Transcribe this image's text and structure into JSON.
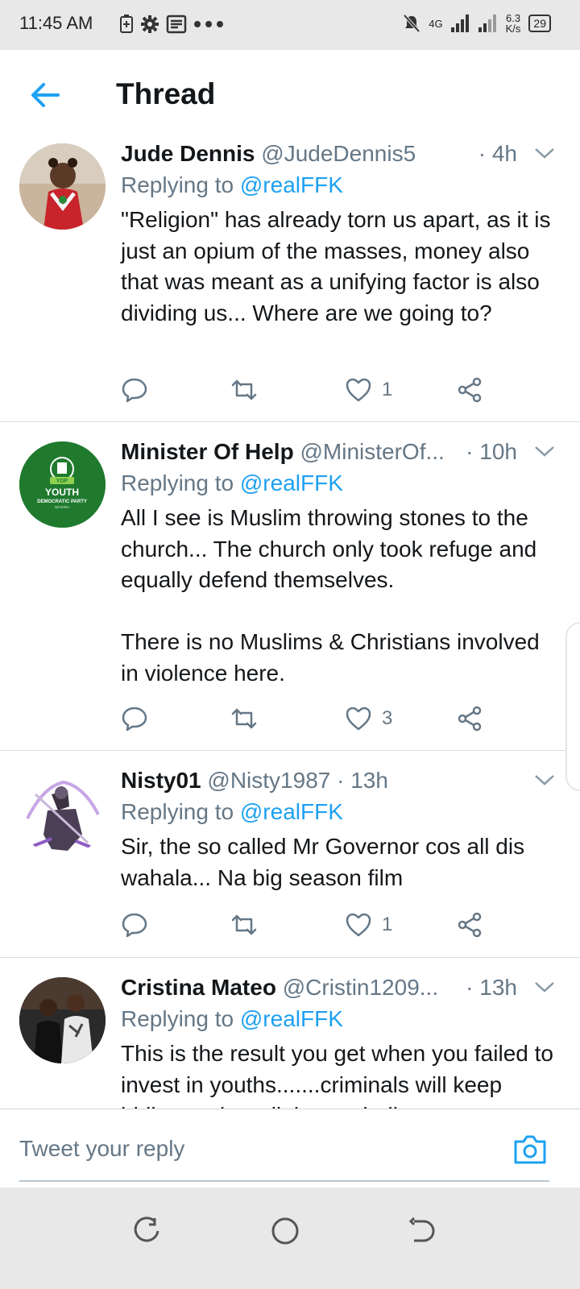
{
  "status_bar": {
    "time": "11:45 AM",
    "network": "4G",
    "speed": "6.3",
    "speed_unit": "K/s",
    "battery": "29"
  },
  "header": {
    "title": "Thread"
  },
  "colors": {
    "accent": "#1da1f2",
    "secondary_text": "#657786",
    "divider": "#d9dde0",
    "ydp_green": "#1f7a2e"
  },
  "tweets": [
    {
      "name": "Jude Dennis",
      "handle": "@JudeDennis5",
      "time": "· 4h",
      "replying_prefix": "Replying to",
      "replying_to": "@realFFK",
      "text": "\"Religion\" has already torn us apart, as it is just an opium of the masses, money also that was meant as a unifying factor is also dividing us... Where are we going to?",
      "likes": "1",
      "avatar": "child-photo"
    },
    {
      "name": "Minister Of Help",
      "handle": "@MinisterOf...",
      "time": "· 10h",
      "replying_prefix": "Replying to",
      "replying_to": "@realFFK",
      "text": "All I see is Muslim throwing stones to the church... The church only took refuge and equally defend themselves.\n\nThere is no Muslims & Christians involved in violence here.",
      "likes": "3",
      "avatar": "ydp-logo",
      "avatar_text": {
        "line1": "YOUTH",
        "line2": "DEMOCRATIC PARTY",
        "line3": "NIGERIA",
        "badge": "YDP"
      }
    },
    {
      "name": "Nisty01",
      "handle": "@Nisty1987",
      "time": "· 13h",
      "replying_prefix": "Replying to",
      "replying_to": "@realFFK",
      "text": "Sir, the so called Mr Governor cos all dis wahala... Na big season film",
      "likes": "1",
      "avatar": "warrior-illustration"
    },
    {
      "name": "Cristina Mateo",
      "handle": "@Cristin1209...",
      "time": "· 13h",
      "replying_prefix": "Replying to",
      "replying_to": "@realFFK",
      "text": "This is the result you get when you failed to invest in youths.......criminals will keep hiding under religion and tribe to",
      "avatar": "couple-photo"
    }
  ],
  "reply_bar": {
    "placeholder": "Tweet your reply"
  },
  "icons": {
    "back": "arrow-left-icon",
    "reply": "comment-icon",
    "retweet": "retweet-icon",
    "like": "heart-icon",
    "share": "share-icon",
    "camera": "camera-icon"
  }
}
